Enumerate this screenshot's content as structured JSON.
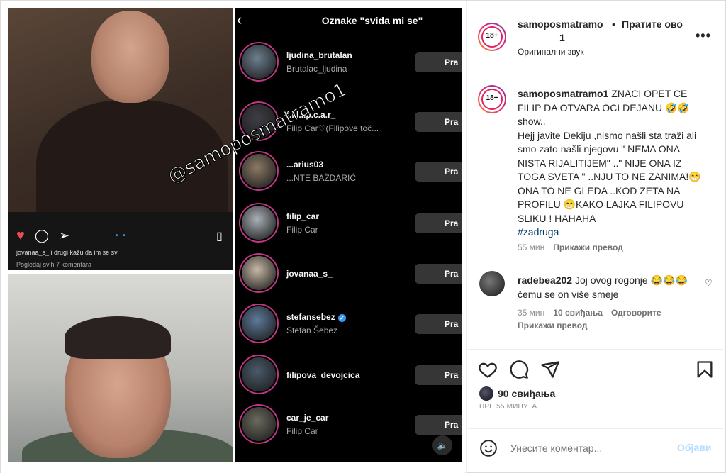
{
  "media": {
    "watermark": "@samoposmatramo1",
    "watermark2": "@samoposmatramo1",
    "mini_caption": "jovanaa_s_ i drugi kažu da im se sv",
    "mini_comments": "Pogledaj svih 7 komentara"
  },
  "likes_panel": {
    "title": "Oznake \"sviđa mi se\"",
    "button_label": "Pra",
    "rows": [
      {
        "username": "ljudina_brutalan",
        "subtitle": "Brutalac_ljudina",
        "verified": false
      },
      {
        "username": "f.i.l.i.p.c.a.r_",
        "subtitle": "Filip Car♡(Filipove toč...",
        "verified": false
      },
      {
        "username": "...arius03",
        "subtitle": "...NTE BAŽDARIĆ",
        "verified": false
      },
      {
        "username": "filip_car",
        "subtitle": "Filip Car",
        "verified": false
      },
      {
        "username": "jovanaa_s_",
        "subtitle": "",
        "verified": false
      },
      {
        "username": "stefansebez",
        "subtitle": "Stefan Šebez",
        "verified": true
      },
      {
        "username": "filipova_devojcica",
        "subtitle": "",
        "verified": false
      },
      {
        "username": "car_je_car",
        "subtitle": "Filip Car",
        "verified": false
      }
    ]
  },
  "header": {
    "username_part1": "samoposmatramo",
    "username_part2": "1",
    "separator": "•",
    "follow_label": "Пратите ово",
    "audio": "Оригинални звук",
    "badge": "18+"
  },
  "caption": {
    "username": "samoposmatramo1",
    "text": "ZNACI OPET CE FILIP DA OTVARA OCI DEJANU 🤣🤣 show..\nHejj javite Dekiju ,nismo našli sta traži ali smo zato našli njegovu \" NEMA ONA NISTA RIJALITIJEM\" ..\" NIJE ONA IZ TOGA SVETA \" ..NJU TO NE ZANIMA!😁ONA TO NE GLEDA ..KOD ZETA NA PROFILU 😁KAKO LAJKA FILIPOVU SLIKU ! HAHAHA",
    "hashtag": "#zadruga",
    "time": "55 мин",
    "translate": "Прикажи превод"
  },
  "comment": {
    "username": "radebea202",
    "text": "Joj ovog rogonje 😂😂😂 čemu se on više smeje",
    "time": "35 мин",
    "likes": "10 свиђања",
    "reply": "Одговорите",
    "translate": "Прикажи превод"
  },
  "actions": {
    "likes_count": "90 свиђања",
    "timestamp": "ПРЕ 55 МИНУТА"
  },
  "comment_bar": {
    "placeholder": "Унесите коментар...",
    "post_label": "Објави"
  },
  "colors": {
    "likes_panel_bg": "#000000",
    "like_heart": "#ed4956",
    "hashtag": "#00376b",
    "post_button": "#b3dbff"
  }
}
